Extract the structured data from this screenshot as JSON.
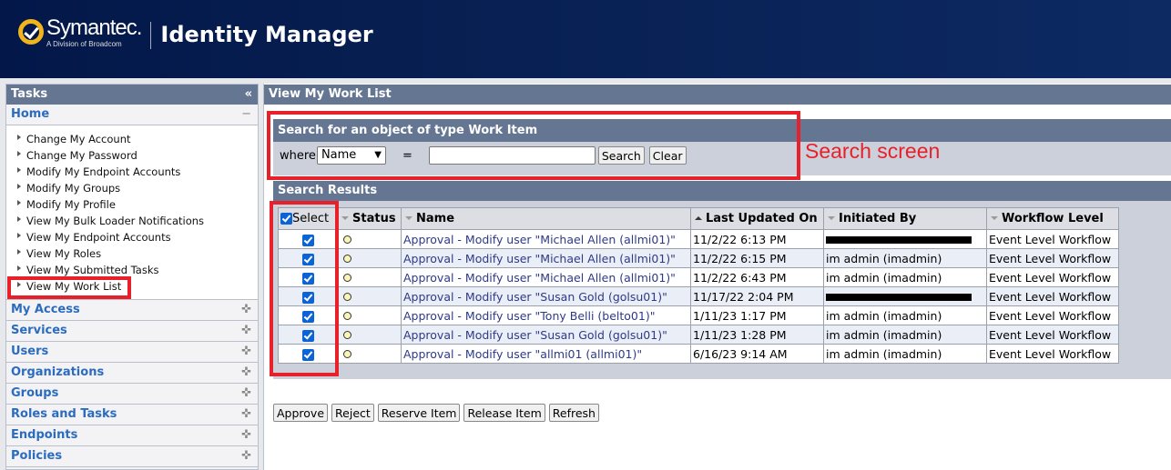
{
  "header": {
    "brand": "Symantec.",
    "brand_sub": "A Division of Broadcom",
    "app_title": "Identity Manager"
  },
  "sidebar": {
    "title": "Tasks",
    "collapse_icon": "«",
    "home": "Home",
    "home_toggle": "−",
    "home_tasks": [
      "Change My Account",
      "Change My Password",
      "Modify My Endpoint Accounts",
      "Modify My Groups",
      "Modify My Profile",
      "View My Bulk Loader Notifications",
      "View My Endpoint Accounts",
      "View My Roles",
      "View My Submitted Tasks",
      "View My Work List"
    ],
    "sections": [
      "My Access",
      "Services",
      "Users",
      "Organizations",
      "Groups",
      "Roles and Tasks",
      "Endpoints",
      "Policies"
    ],
    "expand_icon": "✜"
  },
  "main": {
    "title": "View My Work List",
    "search": {
      "title": "Search for an object of type Work Item",
      "where_label": "where",
      "field_selected": "Name",
      "equals": "=",
      "value": "",
      "search_button": "Search",
      "clear_button": "Clear"
    },
    "annotation": "Search screen",
    "results": {
      "title": "Search Results",
      "columns": [
        "Select",
        "Status",
        "Name",
        "Last Updated On",
        "Initiated By",
        "Workflow Level"
      ],
      "rows": [
        {
          "name": "Approval - Modify user \"Michael Allen (allmi01)\"",
          "updated": "11/2/22 6:13 PM",
          "initiated": "",
          "redacted": true,
          "level": "Event Level Workflow"
        },
        {
          "name": "Approval - Modify user \"Michael Allen (allmi01)\"",
          "updated": "11/2/22 6:15 PM",
          "initiated": "im admin (imadmin)",
          "level": "Event Level Workflow"
        },
        {
          "name": "Approval - Modify user \"Michael Allen (allmi01)\"",
          "updated": "11/2/22 6:43 PM",
          "initiated": "im admin (imadmin)",
          "level": "Event Level Workflow"
        },
        {
          "name": "Approval - Modify user \"Susan Gold (golsu01)\"",
          "updated": "11/17/22 2:04 PM",
          "initiated": "",
          "redacted": true,
          "level": "Event Level Workflow"
        },
        {
          "name": "Approval - Modify user \"Tony Belli (belto01)\"",
          "updated": "1/11/23 1:17 PM",
          "initiated": "im admin (imadmin)",
          "level": "Event Level Workflow"
        },
        {
          "name": "Approval - Modify user \"Susan Gold (golsu01)\"",
          "updated": "1/11/23 1:28 PM",
          "initiated": "im admin (imadmin)",
          "level": "Event Level Workflow"
        },
        {
          "name": "Approval - Modify user \"allmi01 (allmi01)\"",
          "updated": "6/16/23 9:14 AM",
          "initiated": "im admin (imadmin)",
          "level": "Event Level Workflow"
        }
      ]
    },
    "actions": [
      "Approve",
      "Reject",
      "Reserve Item",
      "Release Item",
      "Refresh"
    ]
  },
  "colors": {
    "header_bg": "#0a2357",
    "panel_head": "#657693",
    "link": "#2b6cbf",
    "annotation": "#e8202a"
  }
}
